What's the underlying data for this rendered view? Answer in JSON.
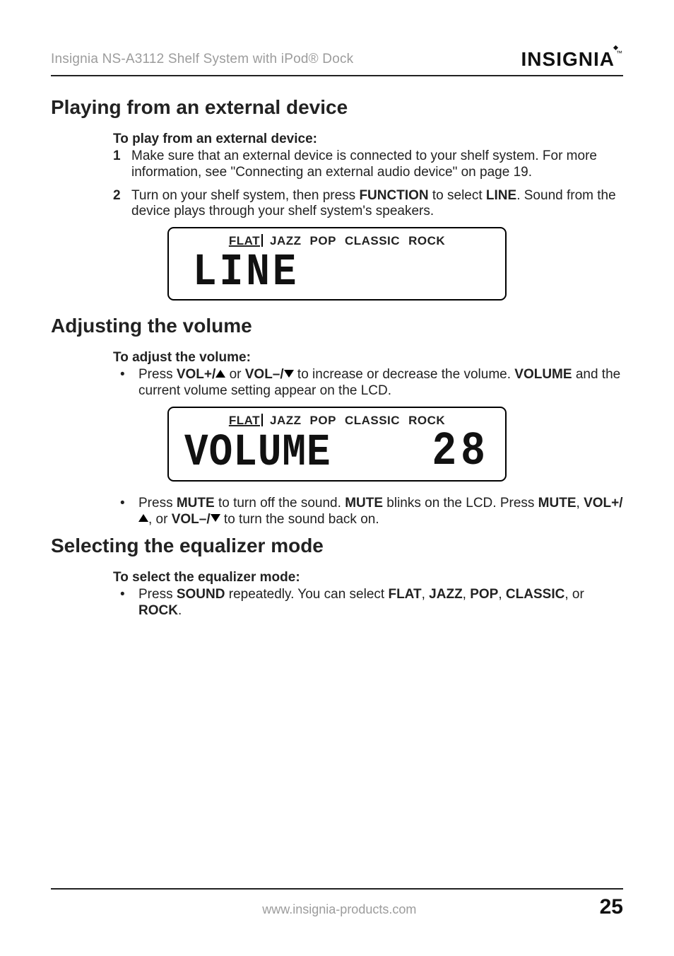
{
  "header": {
    "product_line": "Insignia NS-A3112 Shelf System with iPod® Dock",
    "brand": "INSIGNIA"
  },
  "section1": {
    "title": "Playing from an external device",
    "sub": "To play from an external device:",
    "step1_a": "Make sure that an external device is connected to your shelf system. For more information, see \"Connecting an external audio device\" on page 19.",
    "step2_a": "Turn on your shelf system, then press ",
    "step2_b": "FUNCTION",
    "step2_c": " to select ",
    "step2_d": "LINE",
    "step2_e": ". Sound from the device plays through your shelf system's speakers."
  },
  "lcd1": {
    "eq": [
      "FLAT",
      "JAZZ",
      "POP",
      "CLASSIC",
      "ROCK"
    ],
    "selected": "FLAT",
    "main": "LINE"
  },
  "section2": {
    "title": "Adjusting the volume",
    "sub": "To adjust the volume:",
    "b1_a": "Press ",
    "b1_b": "VOL+/",
    "b1_c": " or ",
    "b1_d": "VOL–/",
    "b1_e": " to increase or decrease the volume. ",
    "b1_f": "VOLUME",
    "b1_g": " and the current volume setting appear on the LCD.",
    "b2_a": "Press ",
    "b2_b": "MUTE",
    "b2_c": " to turn off the sound. ",
    "b2_d": "MUTE",
    "b2_e": " blinks on the LCD. Press ",
    "b2_f": "MUTE",
    "b2_g": ", ",
    "b2_h": "VOL+/",
    "b2_i": ", or ",
    "b2_j": "VOL–/",
    "b2_k": " to turn the sound back on."
  },
  "lcd2": {
    "eq": [
      "FLAT",
      "JAZZ",
      "POP",
      "CLASSIC",
      "ROCK"
    ],
    "selected": "FLAT",
    "main": "VOLUME",
    "value": "28"
  },
  "section3": {
    "title": "Selecting the equalizer mode",
    "sub": "To select the equalizer mode:",
    "b1_a": "Press ",
    "b1_b": "SOUND",
    "b1_c": " repeatedly. You can select ",
    "b1_d": "FLAT",
    "b1_e": ", ",
    "b1_f": "JAZZ",
    "b1_g": ", ",
    "b1_h": "POP",
    "b1_i": ", ",
    "b1_j": "CLASSIC",
    "b1_k": ", or ",
    "b1_l": "ROCK",
    "b1_m": "."
  },
  "footer": {
    "url": "www.insignia-products.com",
    "page": "25"
  }
}
